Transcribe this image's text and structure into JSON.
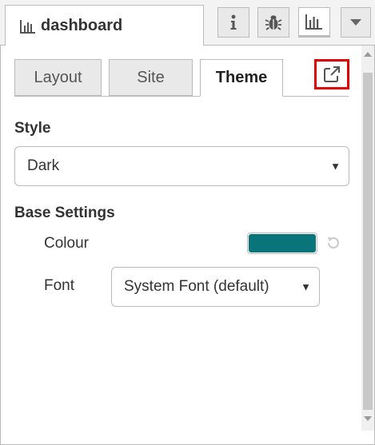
{
  "header": {
    "sidebar_tab_title": "dashboard",
    "icons": [
      "info-icon",
      "bug-icon",
      "bar-chart-icon",
      "chevron-down-icon"
    ]
  },
  "tabs": [
    {
      "label": "Layout",
      "active": false
    },
    {
      "label": "Site",
      "active": false
    },
    {
      "label": "Theme",
      "active": true
    }
  ],
  "style_section": {
    "heading": "Style",
    "selected": "Dark"
  },
  "base_settings": {
    "heading": "Base Settings",
    "colour_label": "Colour",
    "colour_value": "#097479",
    "font_label": "Font",
    "font_selected": "System Font (default)"
  },
  "colors": {
    "highlight": "#e00000",
    "accent": "#097479"
  }
}
